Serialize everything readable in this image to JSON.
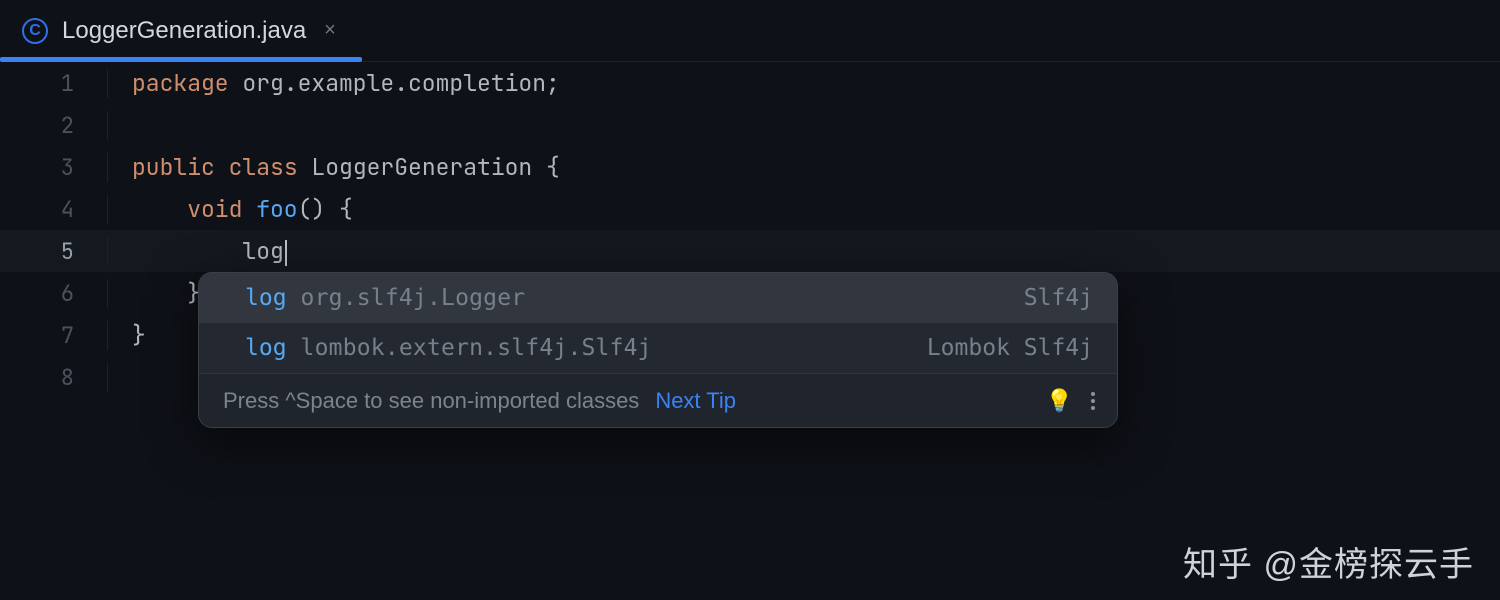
{
  "tab": {
    "icon_letter": "C",
    "filename": "LoggerGeneration.java",
    "close_glyph": "×"
  },
  "gutter_numbers": [
    "1",
    "2",
    "3",
    "4",
    "5",
    "6",
    "7",
    "8"
  ],
  "code": {
    "l1_kw": "package",
    "l1_pkg": " org.example.completion",
    "l1_semi": ";",
    "l3_kw1": "public",
    "l3_kw2": " class",
    "l3_cls": " LoggerGeneration",
    "l3_brace": " {",
    "l4_kw": "void",
    "l4_fn": " foo",
    "l4_rest": "() {",
    "l5_text": "log",
    "l6_brace": "}",
    "l7_brace": "}"
  },
  "completion": {
    "items": [
      {
        "main": "log",
        "detail": "org.slf4j.Logger",
        "tail": "Slf4j",
        "selected": true
      },
      {
        "main": "log",
        "detail": "lombok.extern.slf4j.Slf4j",
        "tail": "Lombok Slf4j",
        "selected": false
      }
    ],
    "footer_hint": "Press ^Space to see non-imported classes",
    "footer_link": "Next Tip"
  },
  "watermark": "知乎 @金榜探云手"
}
